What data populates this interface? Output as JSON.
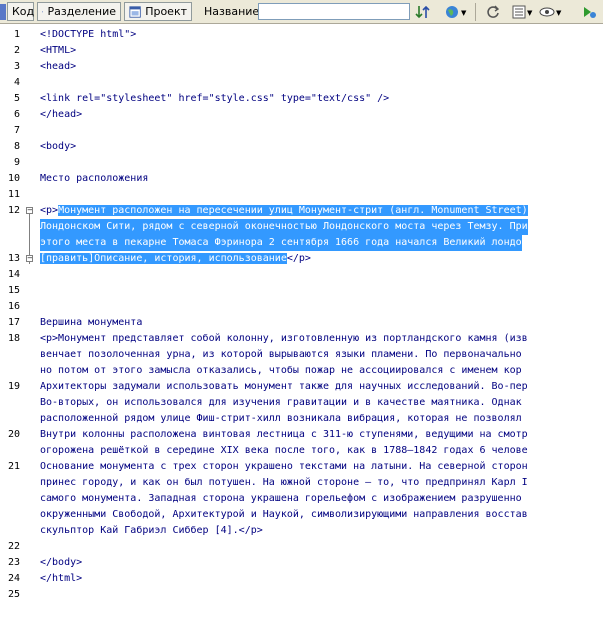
{
  "toolbar": {
    "code_label": "Код",
    "split_label": "Разделение",
    "project_label": "Проект",
    "title_label": "Название:",
    "title_value": ""
  },
  "line_numbers": [
    "1",
    "2",
    "3",
    "4",
    "5",
    "6",
    "7",
    "8",
    "9",
    "10",
    "11",
    "12",
    "13",
    "14",
    "15",
    "16",
    "17",
    "18",
    "19",
    "20",
    "21",
    "22",
    "23",
    "24",
    "25"
  ],
  "code": {
    "l1": "<!DOCTYPE html\">",
    "l2": "<HTML>",
    "l3": "<head>",
    "l5": "<link rel=\"stylesheet\" href=\"style.css\" type=\"text/css\" />",
    "l6": "</head>",
    "l8": "<body>",
    "l10": "Место расположения",
    "l12a_tag": "<p>",
    "l12a_text": "Монумент расположен на пересечении улиц Монумент-стрит (англ. Monument Street)",
    "l12b": "Лондонском Сити, рядом с северной оконечностью Лондонского моста через Темзу. При",
    "l12c": "этого места в пекарне Томаса Фэринора 2 сентября 1666 года начался Великий лондо",
    "l13_text": "[править]Описание, история, использование",
    "l13_tag": "</p>",
    "l17": "Вершина монумента",
    "l18a": "<p>Монумент представляет собой колонну, изготовленную из портландского камня (изв",
    "l18b": "венчает позолоченная урна, из которой вырываются языки пламени. По первоначально",
    "l18c": "но потом от этого замысла отказались, чтобы пожар не ассоциировался с именем кор",
    "l19a": "Архитекторы задумали использовать монумент также для научных исследований. Во-пер",
    "l19b": "Во-вторых, он использовался для изучения гравитации и в качестве маятника. Однак",
    "l19c": "расположенной рядом улице Фиш-стрит-хилл возникала вибрация, которая не позволял",
    "l20a": "Внутри колонны расположена винтовая лестница с 311-ю ступенями, ведущими на смотр",
    "l20b": "огорожена решёткой в середине XIX века после того, как в 1788—1842 годах 6 челове",
    "l21a": "Основание монумента с трех сторон украшено текстами на латыни. На северной сторон",
    "l21b": "принес городу, и как он был потушен. На южной стороне – то, что предпринял Карл I",
    "l21c": "самого монумента. Западная сторона украшена горельефом с изображением разрушенно",
    "l21d": "окруженными Свободой, Архитектурой и Наукой, символизирующими направления восстав",
    "l21e": "скульптор Кай Габриэл Сиббер [4].</p>",
    "l23": "</body>",
    "l24": "</html>"
  }
}
